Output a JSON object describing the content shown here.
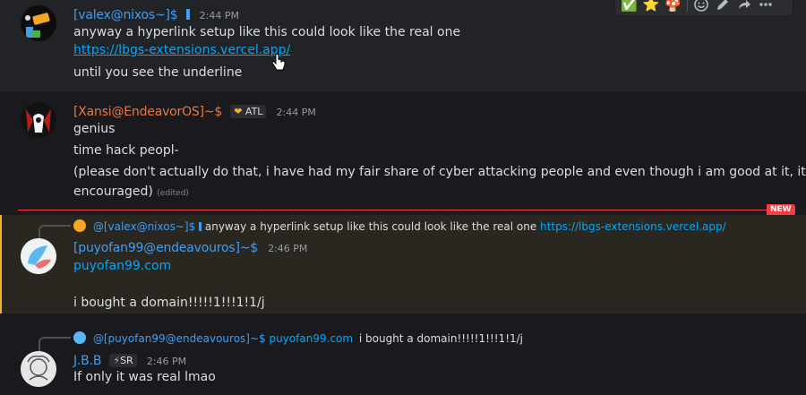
{
  "toolbar": {
    "reactions": [
      "✅",
      "⭐",
      "🍄"
    ],
    "icons": [
      "add-reaction-icon",
      "edit-icon",
      "forward-icon",
      "more-icon"
    ]
  },
  "messages": [
    {
      "username": "[valex@nixos~]$",
      "username_color": "#3d9ff5",
      "time": "2:44 PM",
      "lines": [
        "anyway a hyperlink setup like this could look like the real one"
      ],
      "link": "https://lbgs-extensions.vercel.app/",
      "after_link": "until you see the underline"
    },
    {
      "username": "[Xansi@EndeavorOS]~$",
      "username_color": "#e8793e",
      "badge": "ATL",
      "time": "2:44 PM",
      "lines": [
        "genius",
        "time hack peopl-",
        "(please don't actually do that, i have had my fair share of cyber attacking people and even though i am good at it, its not",
        "encouraged)"
      ],
      "edited": "(edited)"
    },
    {
      "new_label": "NEW",
      "reply": {
        "user": "@[valex@nixos~]$",
        "text": "anyway a hyperlink setup like this could look like the real one",
        "link": "https://lbgs-extensions.vercel.app/"
      },
      "username": "[puyofan99@endeavouros]~$",
      "username_color": "#3d9ff5",
      "time": "2:46 PM",
      "link": "puyofan99.com",
      "text": "i bought a domain!!!!!1!!!1!1/j"
    },
    {
      "reply": {
        "user": "@[puyofan99@endeavouros]~$",
        "link": "puyofan99.com",
        "text": "i bought a domain!!!!!1!!!1!1/j"
      },
      "username": "J.B.B",
      "username_color": "#3d9ff5",
      "badge": "SR",
      "time": "2:46 PM",
      "text": "If only it was real lmao"
    }
  ]
}
